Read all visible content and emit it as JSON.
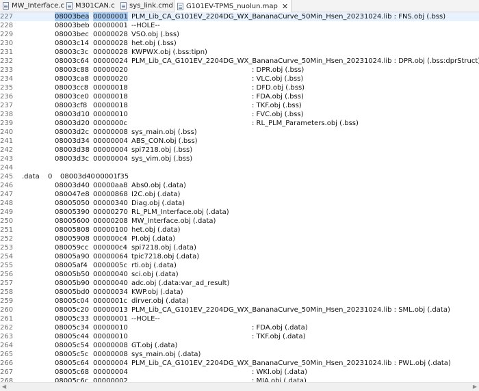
{
  "tabs": [
    {
      "label": "MW_Interface.c",
      "active": false
    },
    {
      "label": "M301CAN.c",
      "active": false
    },
    {
      "label": "sys_link.cmd",
      "active": false
    },
    {
      "label": "G101EV-TPMS_nuolun.map",
      "active": true
    }
  ],
  "tab_close_glyph": "✕",
  "lines": [
    {
      "n": "227",
      "a": "08003bea",
      "b": "00000001",
      "c": "PLM_Lib_CA_G101EV_2204DG_WX_BananaCurve_50Min_Hsen_20231024.lib : FNS.obj (.bss)"
    },
    {
      "n": "228",
      "a": "08003beb",
      "b": "00000001",
      "c": "--HOLE--"
    },
    {
      "n": "229",
      "a": "08003bec",
      "b": "00000028",
      "c": "VSO.obj (.bss)"
    },
    {
      "n": "230",
      "a": "08003c14",
      "b": "00000028",
      "c": "het.obj (.bss)"
    },
    {
      "n": "231",
      "a": "08003c3c",
      "b": "00000028",
      "c": "KWPWX.obj (.bss:tipn)"
    },
    {
      "n": "232",
      "a": "08003c64",
      "b": "00000024",
      "c": "PLM_Lib_CA_G101EV_2204DG_WX_BananaCurve_50Min_Hsen_20231024.lib : DPR.obj (.bss:dprStruct)"
    },
    {
      "n": "233",
      "a": "08003c88",
      "b": "00000020",
      "d": ": DPR.obj (.bss)"
    },
    {
      "n": "234",
      "a": "08003ca8",
      "b": "00000020",
      "d": ": VLC.obj (.bss)"
    },
    {
      "n": "235",
      "a": "08003cc8",
      "b": "00000018",
      "d": ": DFD.obj (.bss)"
    },
    {
      "n": "236",
      "a": "08003ce0",
      "b": "00000018",
      "d": ": FDA.obj (.bss)"
    },
    {
      "n": "237",
      "a": "08003cf8",
      "b": "00000018",
      "d": ": TKF.obj (.bss)"
    },
    {
      "n": "238",
      "a": "08003d10",
      "b": "00000010",
      "d": ": FVC.obj (.bss)"
    },
    {
      "n": "239",
      "a": "08003d20",
      "b": "0000000c",
      "d": ": RL_PLM_Parameters.obj (.bss)"
    },
    {
      "n": "240",
      "a": "08003d2c",
      "b": "00000008",
      "c": "sys_main.obj (.bss)"
    },
    {
      "n": "241",
      "a": "08003d34",
      "b": "00000004",
      "c": "ABS_CON.obj (.bss)"
    },
    {
      "n": "242",
      "a": "08003d38",
      "b": "00000004",
      "c": "spi7218.obj (.bss)"
    },
    {
      "n": "243",
      "a": "08003d3c",
      "b": "00000004",
      "c": "sys_vim.obj (.bss)"
    },
    {
      "n": "244"
    },
    {
      "n": "245",
      "sec": ".data",
      "p": "0",
      "q": "08003d40",
      "r": "00001f35"
    },
    {
      "n": "246",
      "a": "08003d40",
      "b": "00000aa8",
      "c": "Abs0.obj (.data)"
    },
    {
      "n": "247",
      "a": "080047e8",
      "b": "00000868",
      "c": "I2C.obj (.data)"
    },
    {
      "n": "248",
      "a": "08005050",
      "b": "00000340",
      "c": "Diag.obj (.data)"
    },
    {
      "n": "249",
      "a": "08005390",
      "b": "00000270",
      "c": "RL_PLM_Interface.obj (.data)"
    },
    {
      "n": "250",
      "a": "08005600",
      "b": "00000208",
      "c": "MW_Interface.obj (.data)"
    },
    {
      "n": "251",
      "a": "08005808",
      "b": "00000100",
      "c": "het.obj (.data)"
    },
    {
      "n": "252",
      "a": "08005908",
      "b": "000000c4",
      "c": "PI.obj (.data)"
    },
    {
      "n": "253",
      "a": "080059cc",
      "b": "000000c4",
      "c": "spi7218.obj (.data)"
    },
    {
      "n": "254",
      "a": "08005a90",
      "b": "00000064",
      "c": "tpic7218.obj (.data)"
    },
    {
      "n": "255",
      "a": "08005af4",
      "b": "0000005c",
      "c": "rti.obj (.data)"
    },
    {
      "n": "256",
      "a": "08005b50",
      "b": "00000040",
      "c": "sci.obj (.data)"
    },
    {
      "n": "257",
      "a": "08005b90",
      "b": "00000040",
      "c": "adc.obj (.data:var_ad_result)"
    },
    {
      "n": "258",
      "a": "08005bd0",
      "b": "00000034",
      "c": "KWP.obj (.data)"
    },
    {
      "n": "259",
      "a": "08005c04",
      "b": "0000001c",
      "c": "dirver.obj (.data)"
    },
    {
      "n": "260",
      "a": "08005c20",
      "b": "00000013",
      "c": "PLM_Lib_CA_G101EV_2204DG_WX_BananaCurve_50Min_Hsen_20231024.lib : SML.obj (.data)"
    },
    {
      "n": "261",
      "a": "08005c33",
      "b": "00000001",
      "c": "--HOLE--"
    },
    {
      "n": "262",
      "a": "08005c34",
      "b": "00000010",
      "d": ": FDA.obj (.data)"
    },
    {
      "n": "263",
      "a": "08005c44",
      "b": "00000010",
      "d": ": TKF.obj (.data)"
    },
    {
      "n": "264",
      "a": "08005c54",
      "b": "00000008",
      "c": "GT.obj (.data)"
    },
    {
      "n": "265",
      "a": "08005c5c",
      "b": "00000008",
      "c": "sys_main.obj (.data)"
    },
    {
      "n": "266",
      "a": "08005c64",
      "b": "00000004",
      "c": "PLM_Lib_CA_G101EV_2204DG_WX_BananaCurve_50Min_Hsen_20231024.lib : PWL.obj (.data)"
    },
    {
      "n": "267",
      "a": "08005c68",
      "b": "00000004",
      "d": ": WKI.obj (.data)"
    },
    {
      "n": "268",
      "a": "08005c6c",
      "b": "00000002",
      "d": ": MIA.obj (.data)"
    }
  ],
  "colors": {
    "current_line": "#e8f2fe",
    "selection": "#a8cdf5",
    "line_number": "#6e6e6e"
  },
  "scrollbar": {
    "left_arrow": "◀",
    "right_arrow": "▶"
  }
}
